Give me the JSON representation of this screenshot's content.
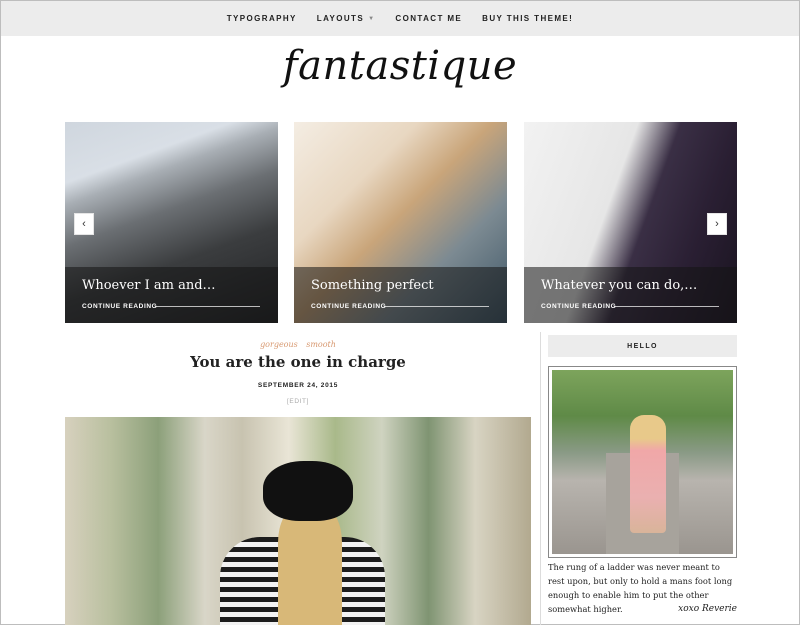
{
  "nav": {
    "items": [
      "TYPOGRAPHY",
      "LAYOUTS",
      "CONTACT ME",
      "BUY THIS THEME!"
    ]
  },
  "site": {
    "logo": "fantastique"
  },
  "slider": {
    "slides": [
      {
        "title": "Whoever I am and…",
        "more": "CONTINUE READING"
      },
      {
        "title": "Something perfect",
        "more": "CONTINUE READING"
      },
      {
        "title": "Whatever you can do,…",
        "more": "CONTINUE READING"
      }
    ],
    "prev_icon": "chevron-left-icon",
    "next_icon": "chevron-right-icon"
  },
  "post": {
    "tags": [
      "gorgeous",
      "smooth"
    ],
    "title": "You are the one in charge",
    "date": "SEPTEMBER 24, 2015",
    "edit": "[EDIT]"
  },
  "sidebar": {
    "widget_title": "HELLO",
    "quote": "The rung of a ladder was never meant to rest upon, but only to hold a mans foot long enough to enable him to put the other somewhat higher.",
    "signature": "xoxo Reverie"
  }
}
